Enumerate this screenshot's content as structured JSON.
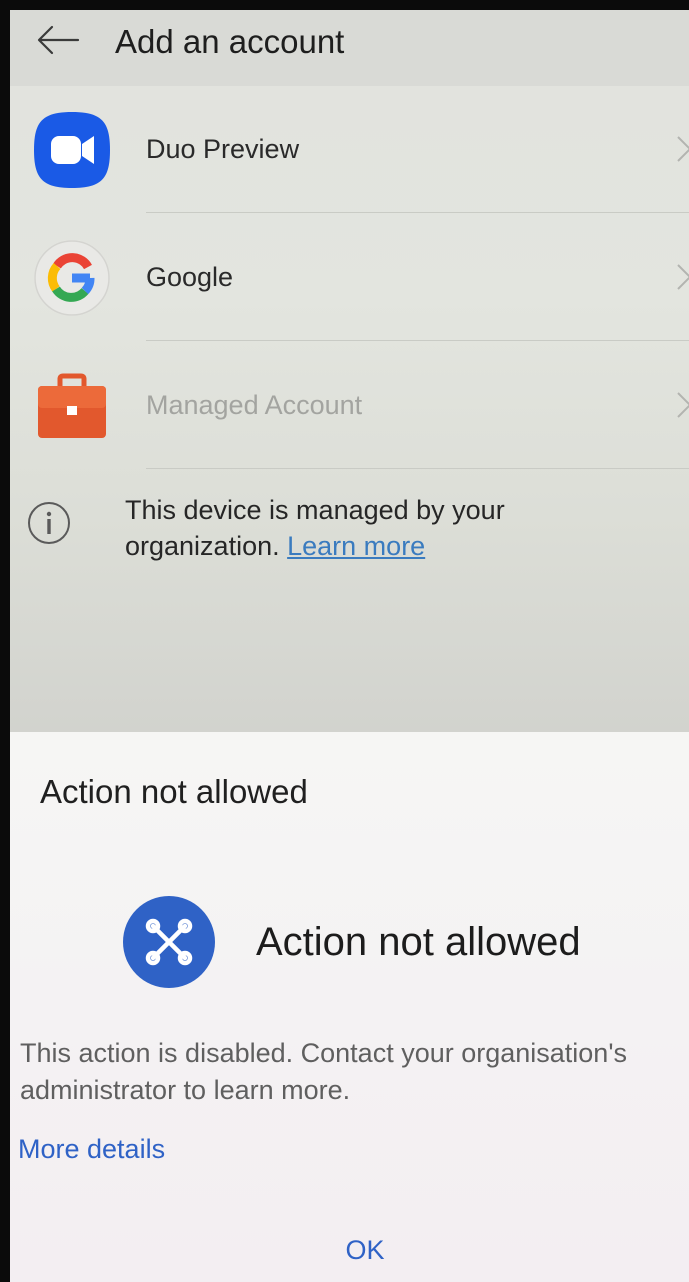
{
  "header": {
    "title": "Add an account",
    "back_icon": "arrow-left-icon"
  },
  "accounts": [
    {
      "label": "Duo Preview",
      "icon": "video-camera-icon",
      "enabled": true
    },
    {
      "label": "Google",
      "icon": "google-g-icon",
      "enabled": true
    },
    {
      "label": "Managed Account",
      "icon": "briefcase-icon",
      "enabled": false
    }
  ],
  "info": {
    "icon": "info-icon",
    "text": "This device is managed by your organization.",
    "link": "Learn more"
  },
  "dialog": {
    "title": "Action not allowed",
    "badge_icon": "blocked-x-icon",
    "badge_text": "Action not allowed",
    "body": "This action is disabled. Contact your organisation's administrator to learn more.",
    "more_details": "More details",
    "ok": "OK"
  },
  "colors": {
    "accent_blue": "#2f62c6",
    "duo_blue": "#1a5ae6",
    "briefcase_orange": "#e2582d",
    "link_blue": "#3a7bbf"
  }
}
